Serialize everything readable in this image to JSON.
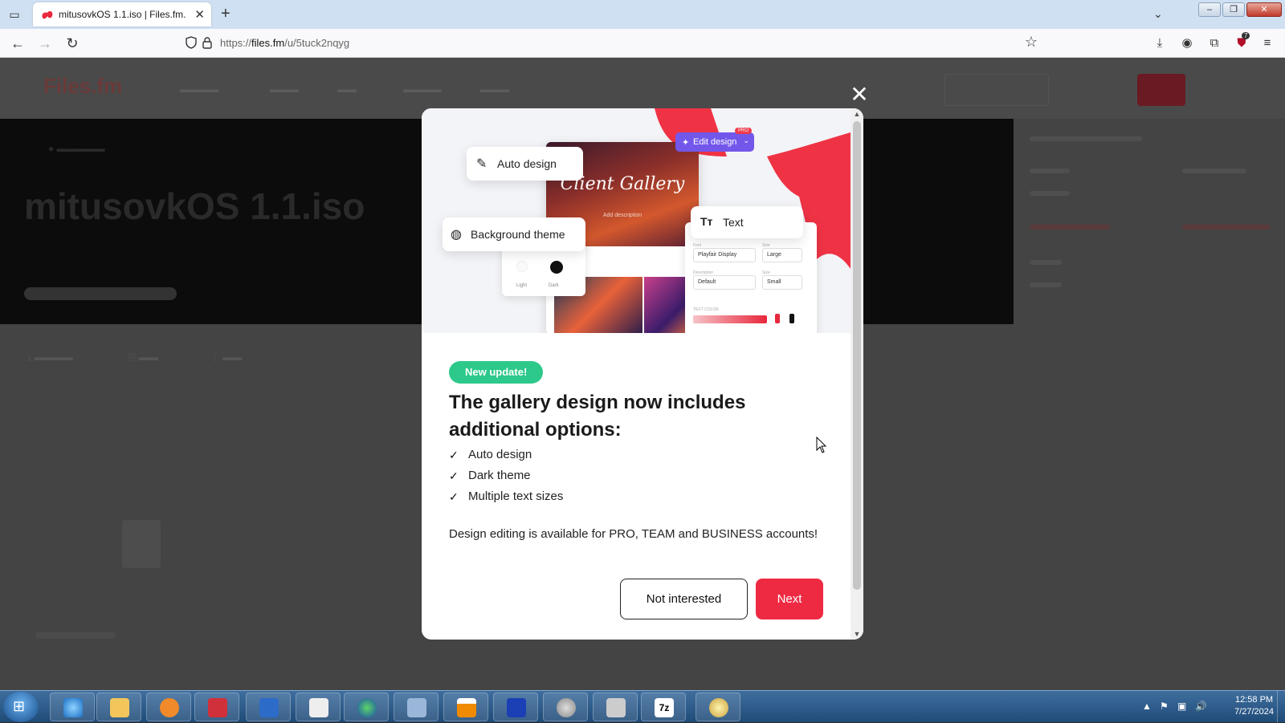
{
  "browser": {
    "tab_title": "mitusovkOS 1.1.iso | Files.fm.",
    "url_prefix": "https://",
    "url_host": "files.fm",
    "url_path": "/u/5tuck2nqyg",
    "ublock_count": "7"
  },
  "page": {
    "logo_text": "Files.fm",
    "hero_title": "mitusovkOS 1.1.iso"
  },
  "modal": {
    "illustration": {
      "auto_design_label": "Auto design",
      "background_theme_label": "Background theme",
      "text_label": "Text",
      "edit_design_label": "Edit design",
      "pro_badge": "PRO",
      "gallery_title": "Client Gallery",
      "gallery_subtitle": "Add description",
      "theme_light": "Light",
      "theme_dark": "Dark",
      "font_value": "Playfair Display",
      "size_large": "Large",
      "desc_value": "Default",
      "size_small": "Small",
      "text_color_label": "TEXT COLOR"
    },
    "badge": "New update!",
    "headline": "The gallery design now includes additional options:",
    "features": [
      "Auto design",
      "Dark theme",
      "Multiple text sizes"
    ],
    "note": "Design editing is available for PRO, TEAM and BUSINESS accounts!",
    "secondary_button": "Not interested",
    "primary_button": "Next"
  },
  "taskbar": {
    "time": "12:58 PM",
    "date": "7/27/2024"
  },
  "colors": {
    "accent_red": "#ee2a43",
    "badge_green": "#2dc98a",
    "edit_purple": "#7357ea"
  }
}
